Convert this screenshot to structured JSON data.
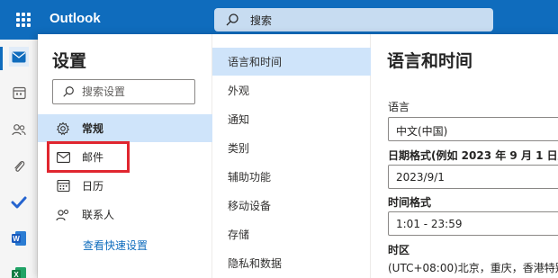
{
  "header": {
    "app_title": "Outlook",
    "search_placeholder": "搜索"
  },
  "rail": {
    "items": [
      "mail-icon",
      "calendar-icon",
      "people-icon",
      "attach-icon",
      "todo-icon",
      "word-icon",
      "excel-icon"
    ]
  },
  "settings": {
    "title": "设置",
    "search_placeholder": "搜索设置",
    "nav": [
      {
        "label": "常规",
        "icon": "gear-icon",
        "active": true
      },
      {
        "label": "邮件",
        "icon": "mail-icon",
        "active": false
      },
      {
        "label": "日历",
        "icon": "calendar-icon",
        "active": false
      },
      {
        "label": "联系人",
        "icon": "people-icon",
        "active": false
      }
    ],
    "quick_link": "查看快速设置",
    "subnav": [
      {
        "label": "语言和时间",
        "active": true
      },
      {
        "label": "外观",
        "active": false
      },
      {
        "label": "通知",
        "active": false
      },
      {
        "label": "类别",
        "active": false
      },
      {
        "label": "辅助功能",
        "active": false
      },
      {
        "label": "移动设备",
        "active": false
      },
      {
        "label": "存储",
        "active": false
      },
      {
        "label": "隐私和数据",
        "active": false
      }
    ]
  },
  "content": {
    "heading": "语言和时间",
    "language_label": "语言",
    "language_value": "中文(中国)",
    "date_format_label": "日期格式(例如 2023 年 9 月 1 日显",
    "date_format_value": "2023/9/1",
    "time_format_label": "时间格式",
    "time_format_value": "1:01 - 23:59",
    "timezone_label": "时区",
    "timezone_value": "(UTC+08:00)北京，重庆，香港特别"
  },
  "colors": {
    "brand": "#0f6cbd",
    "selected": "#cfe4fa",
    "highlight": "#e0262f"
  }
}
